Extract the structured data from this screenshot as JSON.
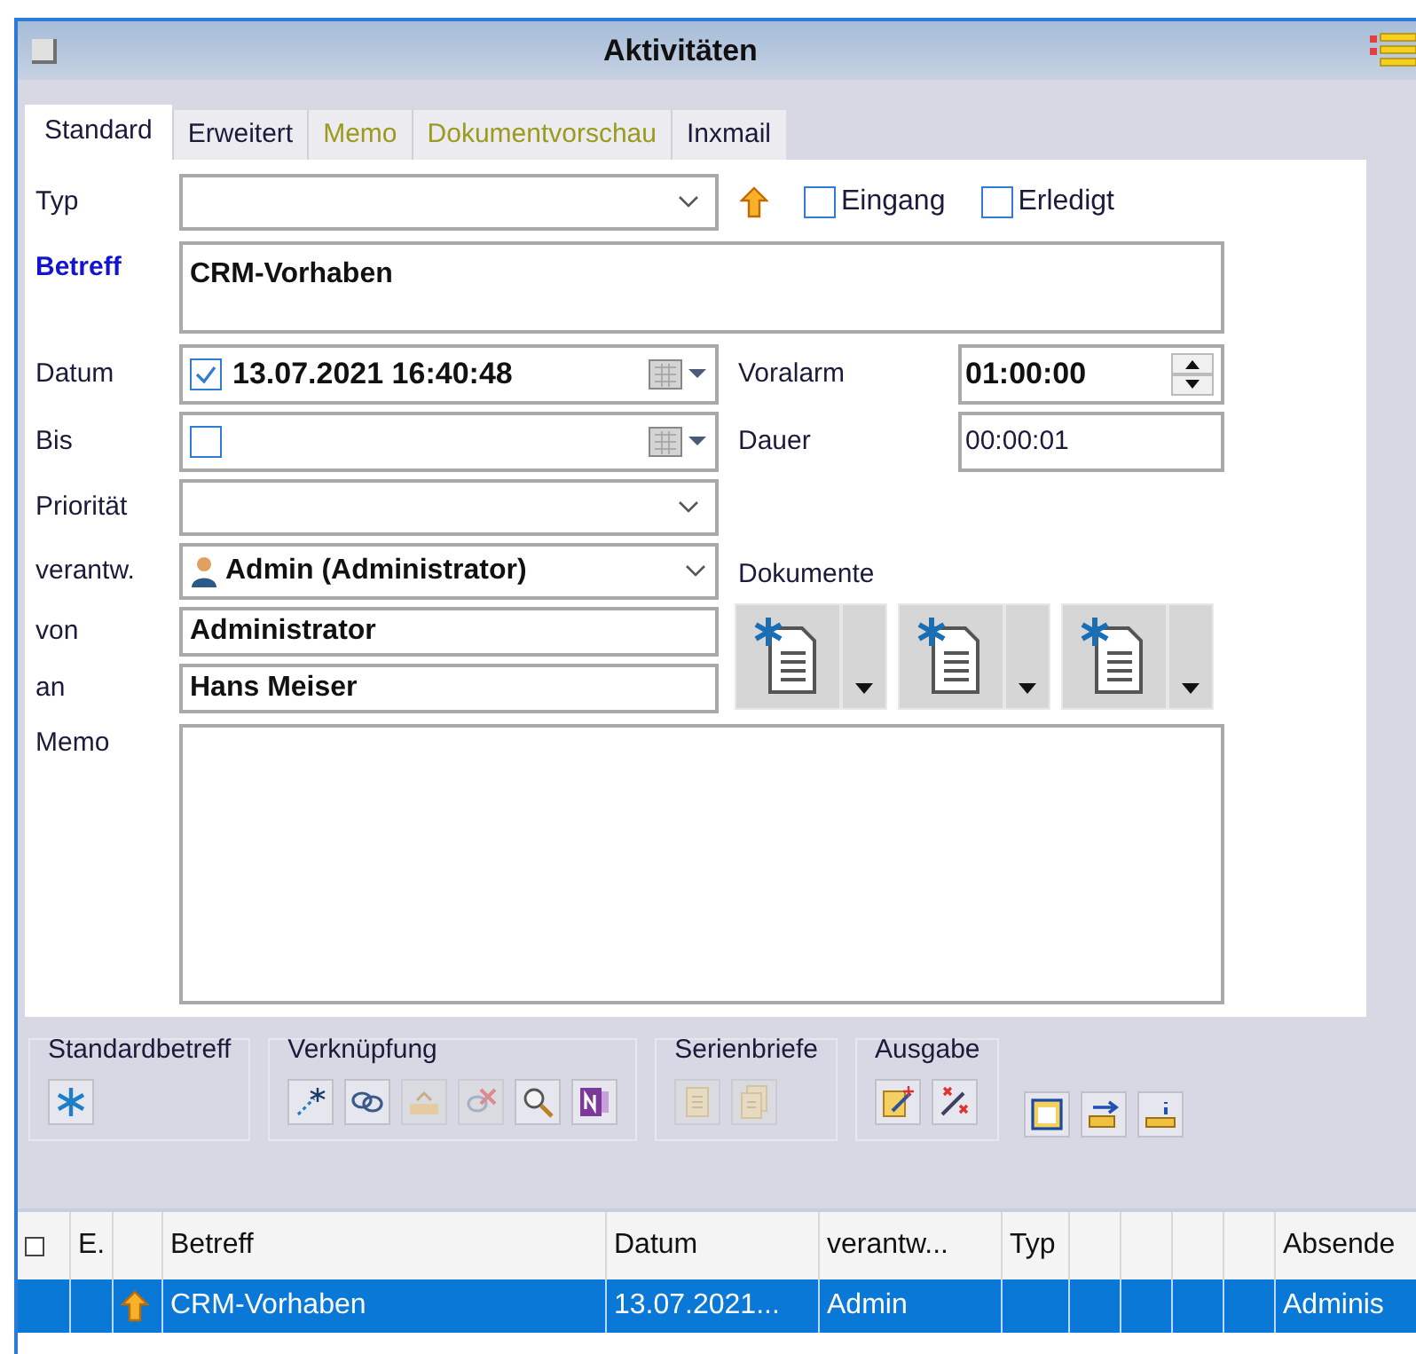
{
  "window": {
    "title": "Aktivitäten"
  },
  "tabs": [
    {
      "label": "Standard",
      "selected": true,
      "color": "#1a1a3a"
    },
    {
      "label": "Erweitert",
      "selected": false,
      "color": "#1a1a3a"
    },
    {
      "label": "Memo",
      "selected": false,
      "color": "#9a9a1e"
    },
    {
      "label": "Dokumentvorschau",
      "selected": false,
      "color": "#9a9a1e"
    },
    {
      "label": "Inxmail",
      "selected": false,
      "color": "#1a1a3a"
    }
  ],
  "form": {
    "type": {
      "label": "Typ"
    },
    "flags": [
      {
        "label": "Eingang",
        "checked": false
      },
      {
        "label": "Erledigt",
        "checked": false
      }
    ],
    "subject": {
      "label": "Betreff",
      "value": "CRM-Vorhaben"
    },
    "date": {
      "label": "Datum",
      "checked": true,
      "value": "13.07.2021 16:40:48"
    },
    "until": {
      "label": "Bis",
      "checked": false
    },
    "priority": {
      "label": "Priorität"
    },
    "responsible": {
      "label": "verantw.",
      "value": "Admin (Administrator)"
    },
    "from": {
      "label": "von",
      "value": "Administrator"
    },
    "to": {
      "label": "an",
      "value": "Hans Meiser"
    },
    "memo": {
      "label": "Memo"
    },
    "pre_alarm": {
      "label": "Voralarm",
      "value": "01:00:00"
    },
    "duration": {
      "label": "Dauer",
      "value": "00:00:01"
    },
    "documents": {
      "label": "Dokumente",
      "buttons": [
        {
          "kind": "new-document"
        },
        {
          "kind": "new-document"
        },
        {
          "kind": "new-document"
        }
      ]
    }
  },
  "toolbar": [
    {
      "label": "Standardbetreff",
      "buttons": [
        {
          "kind": "asterisk",
          "disabled": false
        }
      ]
    },
    {
      "label": "Verknüpfung",
      "buttons": [
        {
          "kind": "new-link",
          "disabled": false
        },
        {
          "kind": "link",
          "disabled": false
        },
        {
          "kind": "tray",
          "disabled": true
        },
        {
          "kind": "delete-link",
          "disabled": true
        },
        {
          "kind": "search",
          "disabled": false
        },
        {
          "kind": "notebook",
          "disabled": false
        }
      ]
    },
    {
      "label": "Serienbriefe",
      "buttons": [
        {
          "kind": "page",
          "disabled": true
        },
        {
          "kind": "pages",
          "disabled": true
        }
      ]
    },
    {
      "label": "Ausgabe",
      "buttons": [
        {
          "kind": "edit-sparkle",
          "disabled": false
        },
        {
          "kind": "wand",
          "disabled": false
        }
      ]
    },
    {
      "buttons": [
        {
          "kind": "calendar",
          "disabled": false
        },
        {
          "kind": "export",
          "disabled": false
        },
        {
          "kind": "info-tray",
          "disabled": false
        }
      ]
    }
  ],
  "table": {
    "columns": [
      {
        "kind": "check",
        "checked": false
      },
      {
        "kind": "text",
        "label": "E."
      },
      {
        "kind": "blank"
      },
      {
        "kind": "text",
        "label": "Betreff"
      },
      {
        "kind": "text",
        "label": "Datum"
      },
      {
        "kind": "text",
        "label": "verantw..."
      },
      {
        "kind": "text",
        "label": "Typ"
      },
      {
        "kind": "blank"
      },
      {
        "kind": "blank"
      },
      {
        "kind": "blank"
      },
      {
        "kind": "blank"
      },
      {
        "kind": "text",
        "label": "Absende"
      }
    ],
    "rows": [
      {
        "selected": true,
        "cells": [
          {
            "kind": "blank"
          },
          {
            "kind": "blank"
          },
          {
            "kind": "priority"
          },
          {
            "kind": "text",
            "text": "CRM-Vorhaben"
          },
          {
            "kind": "text",
            "text": "13.07.2021..."
          },
          {
            "kind": "text",
            "text": "Admin"
          },
          {
            "kind": "blank"
          },
          {
            "kind": "blank"
          },
          {
            "kind": "blank"
          },
          {
            "kind": "blank"
          },
          {
            "kind": "blank"
          },
          {
            "kind": "text",
            "text": "Adminis"
          }
        ]
      }
    ]
  }
}
